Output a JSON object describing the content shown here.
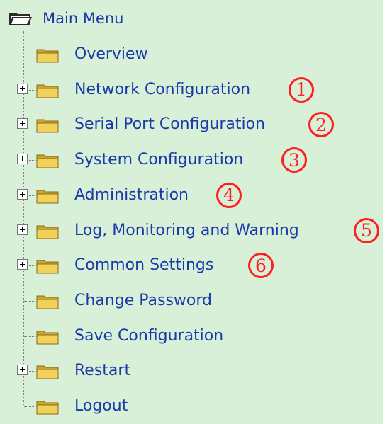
{
  "root": {
    "label": "Main Menu",
    "icon": "open-folder-icon"
  },
  "items": [
    {
      "name": "overview",
      "label": "Overview",
      "expandable": false,
      "badge": ""
    },
    {
      "name": "network-configuration",
      "label": "Network Configuration",
      "expandable": true,
      "badge": "1"
    },
    {
      "name": "serial-port-configuration",
      "label": "Serial Port Configuration",
      "expandable": true,
      "badge": "2"
    },
    {
      "name": "system-configuration",
      "label": "System Configuration",
      "expandable": true,
      "badge": "3"
    },
    {
      "name": "administration",
      "label": "Administration",
      "expandable": true,
      "badge": "4"
    },
    {
      "name": "log-monitoring-warning",
      "label": "Log, Monitoring and Warning",
      "expandable": true,
      "badge": "5"
    },
    {
      "name": "common-settings",
      "label": "Common Settings",
      "expandable": true,
      "badge": "6"
    },
    {
      "name": "change-password",
      "label": "Change Password",
      "expandable": false,
      "badge": ""
    },
    {
      "name": "save-configuration",
      "label": "Save Configuration",
      "expandable": false,
      "badge": ""
    },
    {
      "name": "restart",
      "label": "Restart",
      "expandable": true,
      "badge": ""
    },
    {
      "name": "logout",
      "label": "Logout",
      "expandable": false,
      "badge": ""
    }
  ],
  "colors": {
    "panel_bg": "#d8f0d8",
    "link": "#1a3aa8",
    "badge": "#ff1f1f",
    "folder": "#f2d15a"
  }
}
